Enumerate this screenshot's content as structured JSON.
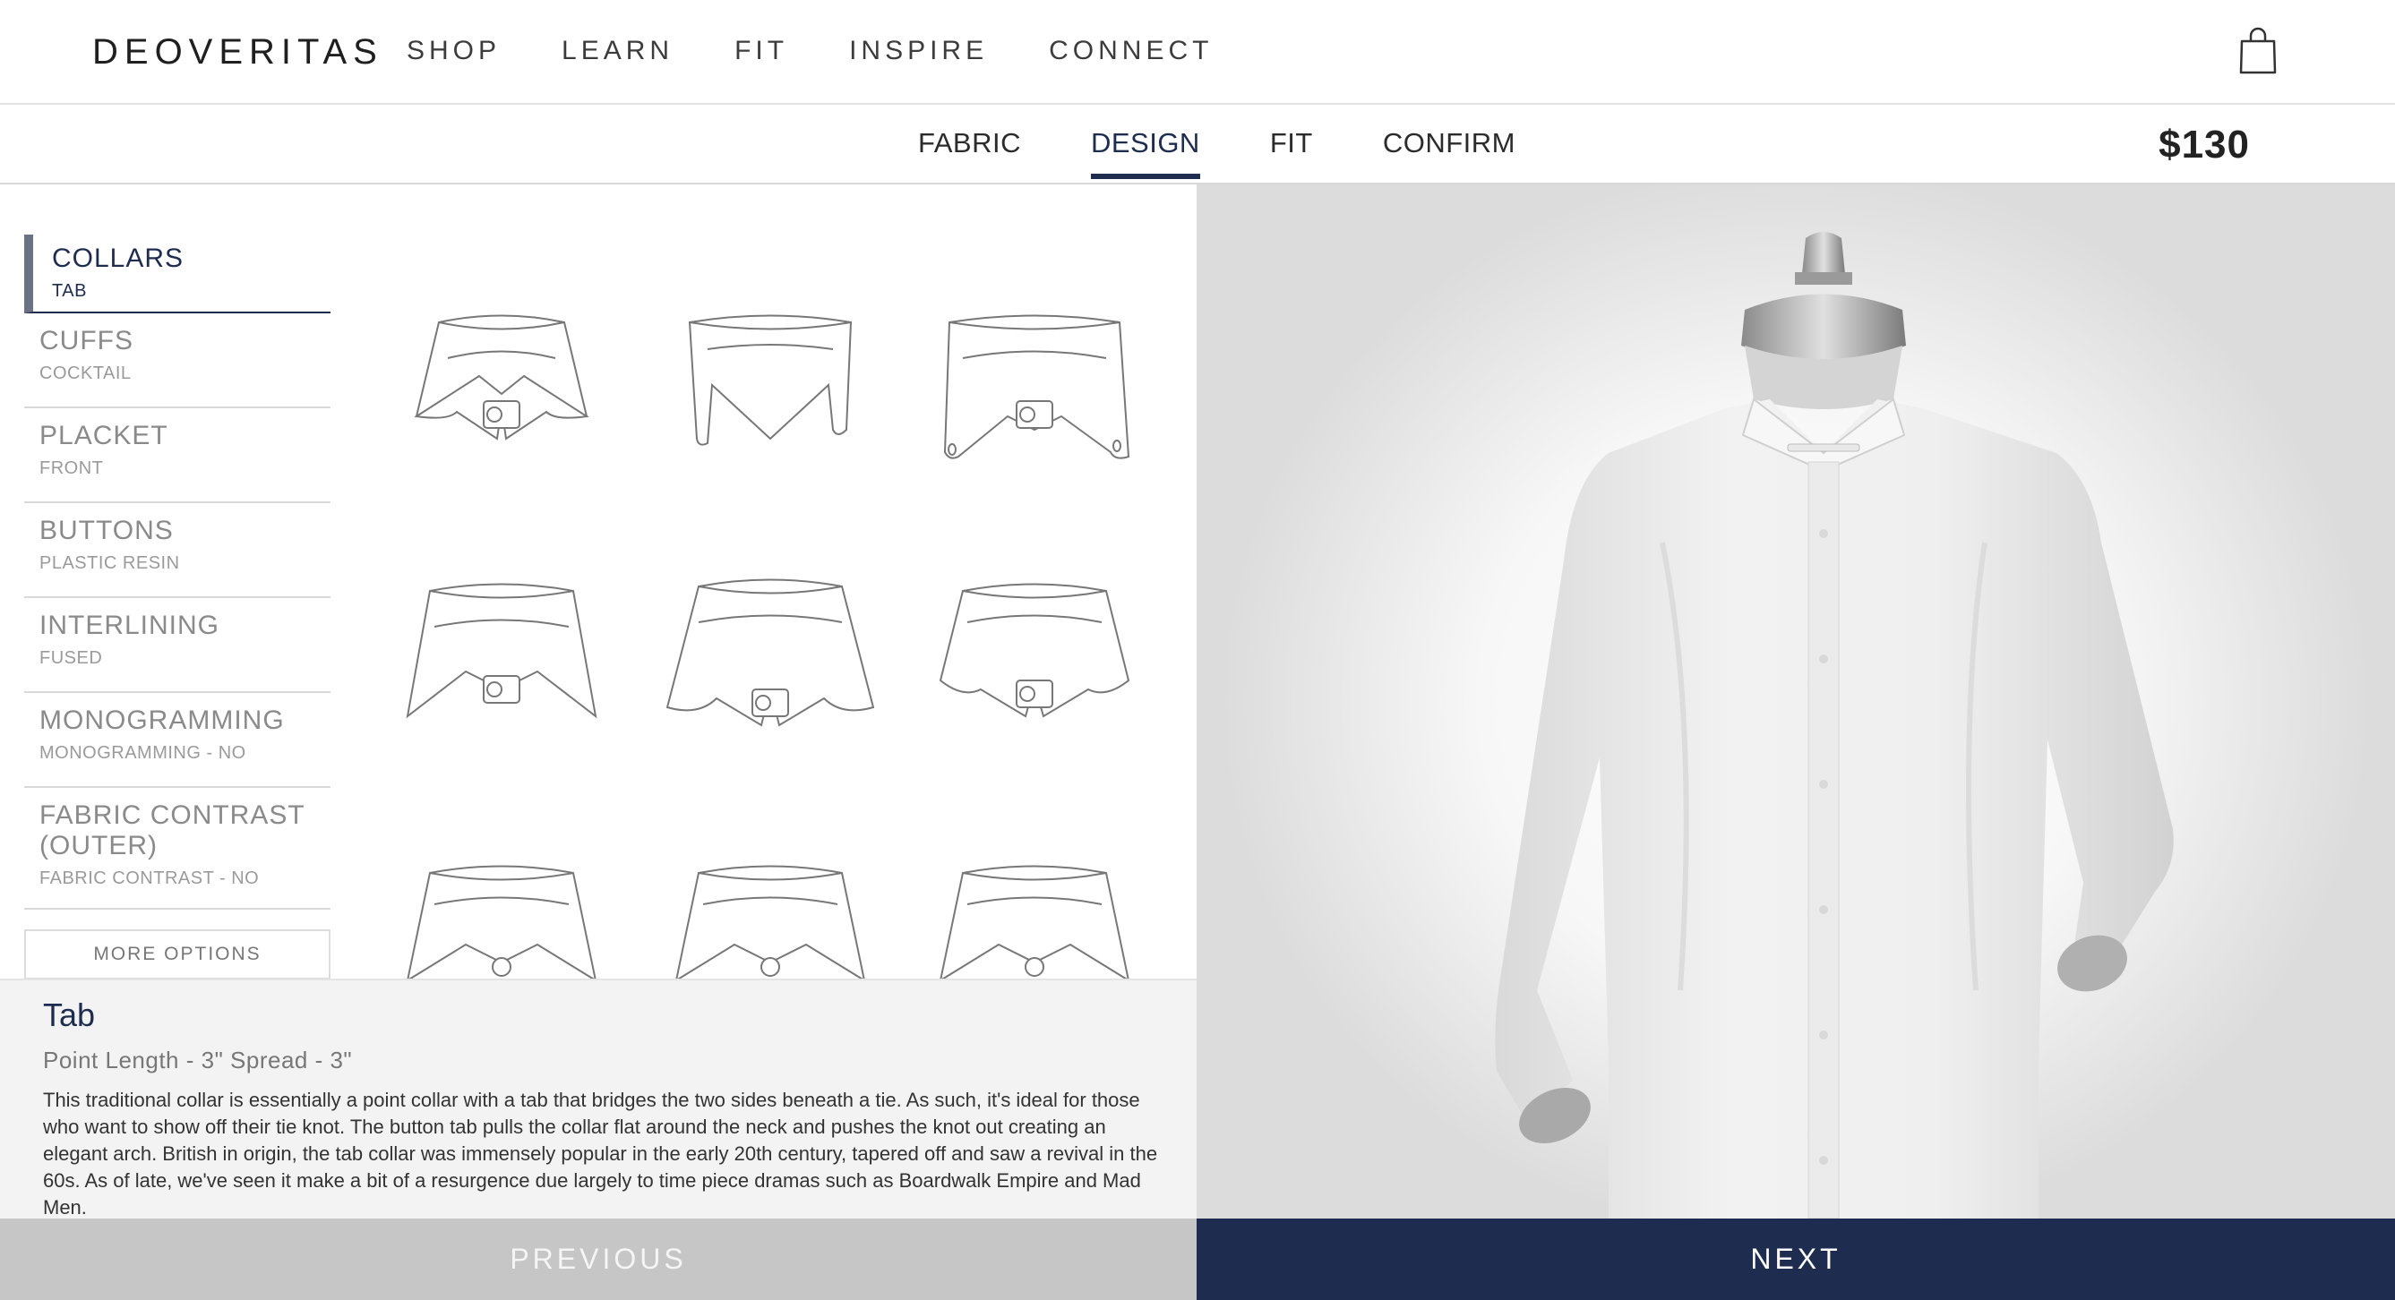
{
  "header": {
    "brand": "DEOVERITAS",
    "nav": [
      "SHOP",
      "LEARN",
      "FIT",
      "INSPIRE",
      "CONNECT"
    ],
    "cart_icon": "shopping-bag-icon"
  },
  "steps": {
    "items": [
      "FABRIC",
      "DESIGN",
      "FIT",
      "CONFIRM"
    ],
    "active": "DESIGN",
    "price": "$130"
  },
  "sidebar": {
    "items": [
      {
        "title": "COLLARS",
        "sub": "TAB"
      },
      {
        "title": "CUFFS",
        "sub": "COCKTAIL"
      },
      {
        "title": "PLACKET",
        "sub": "FRONT"
      },
      {
        "title": "BUTTONS",
        "sub": "PLASTIC RESIN"
      },
      {
        "title": "INTERLINING",
        "sub": "FUSED"
      },
      {
        "title": "MONOGRAMMING",
        "sub": "MONOGRAMMING - NO"
      },
      {
        "title": "FABRIC CONTRAST (OUTER)",
        "sub": "FABRIC CONTRAST - NO"
      }
    ],
    "more_label": "MORE OPTIONS"
  },
  "info": {
    "title": "Tab",
    "subtitle": "Point Length - 3\" Spread - 3\"",
    "description": "This traditional collar is essentially a point collar with a tab that bridges the two sides beneath a tie. As such, it's ideal for those who want to show off their tie knot. The button tab pulls the collar flat around the neck and pushes the knot out creating an elegant arch. British in origin, the tab collar was immensely popular in the early 20th century, tapered off and saw a revival in the 60s. As of late, we've seen it make a bit of a resurgence due largely to time piece dramas such as Boardwalk Empire and Mad Men."
  },
  "footer": {
    "previous": "PREVIOUS",
    "next": "NEXT"
  }
}
